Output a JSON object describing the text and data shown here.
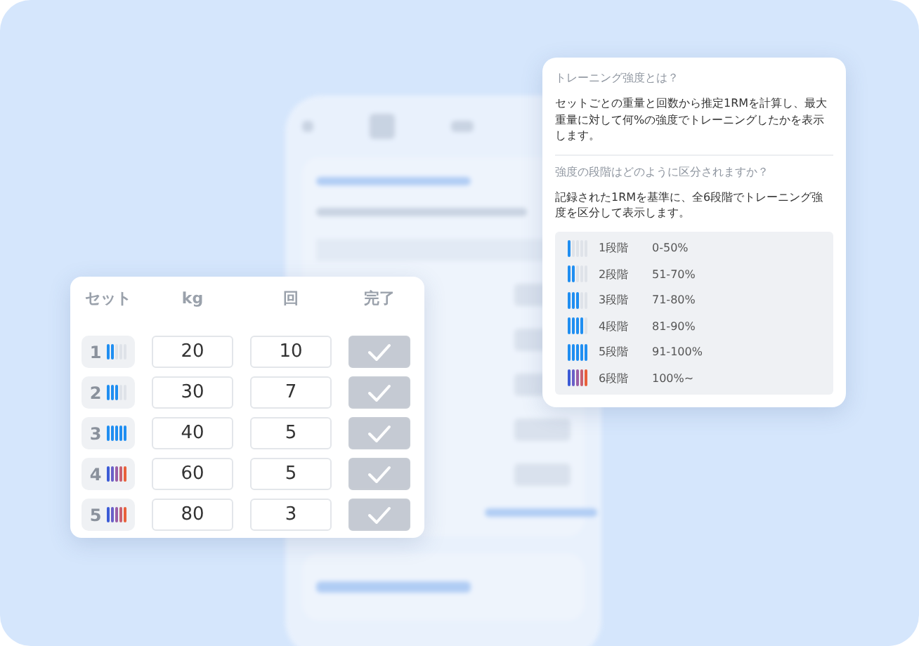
{
  "sets_card": {
    "columns": [
      "セット",
      "kg",
      "回",
      "完了"
    ],
    "rows": [
      {
        "set": "1",
        "level": 0.4,
        "kind": "normal",
        "kg": "20",
        "reps": "10",
        "done": true
      },
      {
        "set": "2",
        "level": 0.6,
        "kind": "normal",
        "kg": "30",
        "reps": "7",
        "done": true
      },
      {
        "set": "3",
        "level": 1,
        "kind": "normal",
        "kg": "40",
        "reps": "5",
        "done": true
      },
      {
        "set": "4",
        "level": 1,
        "kind": "max",
        "kg": "60",
        "reps": "5",
        "done": true
      },
      {
        "set": "5",
        "level": 1,
        "kind": "max",
        "kg": "80",
        "reps": "3",
        "done": true
      }
    ]
  },
  "help_card": {
    "question_1": "トレーニング強度とは？",
    "answer_1": "セットごとの重量と回数から推定1RMを計算し、最大重量に対して何%の強度でトレーニングしたかを表示します。",
    "question_2": "強度の段階はどのように区分されますか？",
    "answer_2": "記録された1RMを基準に、全6段階でトレーニング強度を区分して表示します。",
    "stages": [
      {
        "label": "1段階",
        "range": "0-50%",
        "level": 0.2,
        "kind": "normal"
      },
      {
        "label": "2段階",
        "range": "51-70%",
        "level": 0.4,
        "kind": "normal"
      },
      {
        "label": "3段階",
        "range": "71-80%",
        "level": 0.6,
        "kind": "normal"
      },
      {
        "label": "4段階",
        "range": "81-90%",
        "level": 0.8,
        "kind": "normal"
      },
      {
        "label": "5段階",
        "range": "91-100%",
        "level": 1,
        "kind": "normal"
      },
      {
        "label": "6段階",
        "range": "100%~",
        "level": 1,
        "kind": "max"
      }
    ]
  }
}
